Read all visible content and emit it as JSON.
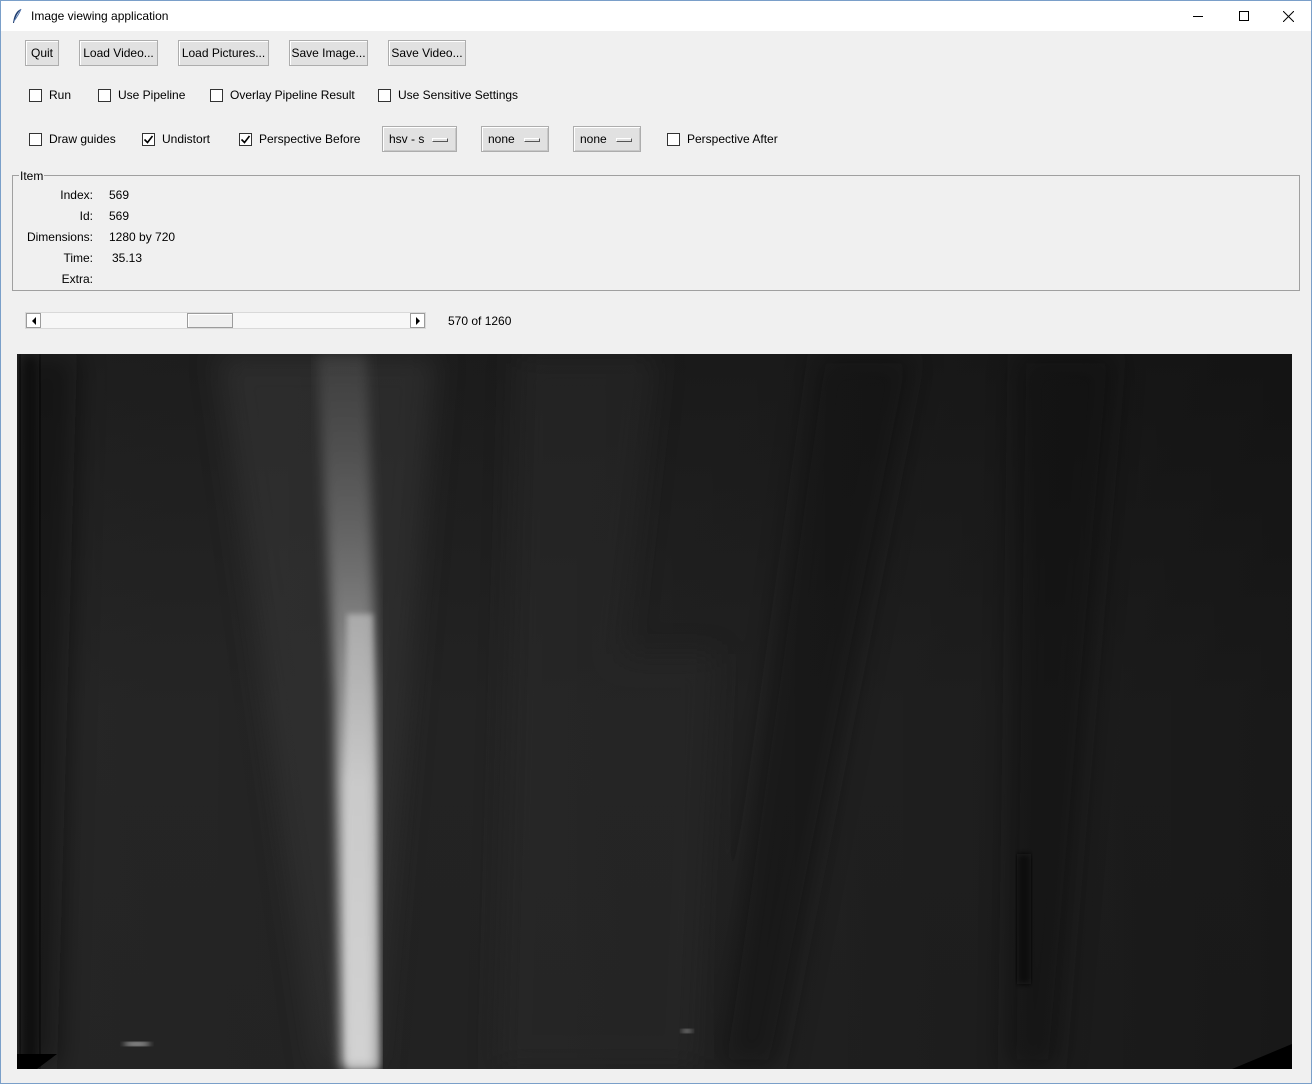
{
  "window": {
    "title": "Image viewing application"
  },
  "toolbar": {
    "buttons": [
      "Quit",
      "Load Video...",
      "Load Pictures...",
      "Save Image...",
      "Save Video..."
    ]
  },
  "options_row1": [
    {
      "label": "Run",
      "checked": false
    },
    {
      "label": "Use Pipeline",
      "checked": false
    },
    {
      "label": "Overlay Pipeline Result",
      "checked": false
    },
    {
      "label": "Use Sensitive Settings",
      "checked": false
    }
  ],
  "options_row2": {
    "draw_guides": {
      "label": "Draw guides",
      "checked": false
    },
    "undistort": {
      "label": "Undistort",
      "checked": true
    },
    "perspective_before": {
      "label": "Perspective Before",
      "checked": true
    },
    "menus": [
      "hsv - s",
      "none",
      "none"
    ],
    "perspective_after": {
      "label": "Perspective After",
      "checked": false
    }
  },
  "item": {
    "group_label": "Item",
    "fields": [
      {
        "key": "Index:",
        "value": "569"
      },
      {
        "key": "Id:",
        "value": "569"
      },
      {
        "key": "Dimensions:",
        "value": "1280 by 720"
      },
      {
        "key": "Time:",
        "value": "35.13"
      },
      {
        "key": "Extra:",
        "value": ""
      }
    ]
  },
  "navigation": {
    "position_text": "570 of 1260",
    "position_fraction": 0.452
  },
  "colors": {
    "window_bg": "#f0f0f0",
    "button_bg": "#e1e1e1",
    "canvas_bg": "#1c1c1c"
  }
}
